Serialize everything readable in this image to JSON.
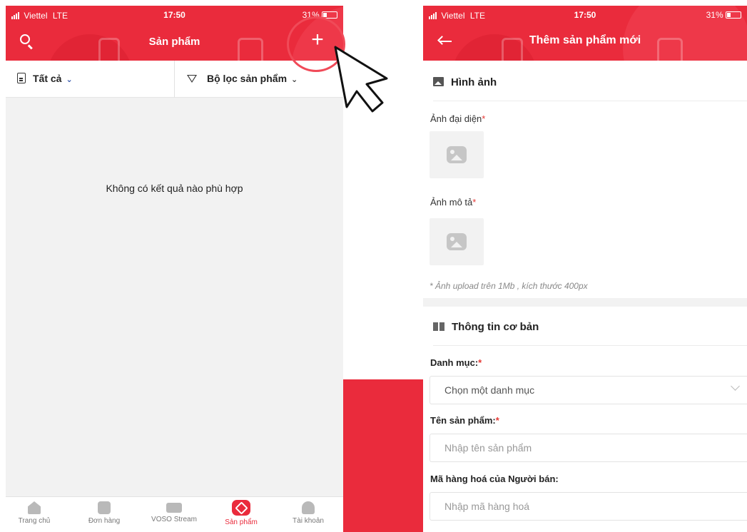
{
  "status_left": {
    "carrier": "Viettel",
    "network": "LTE",
    "time": "17:50",
    "battery": "31%"
  },
  "status_right": {
    "carrier": "Viettel",
    "network": "LTE",
    "time": "17:50",
    "battery": "31%"
  },
  "products_screen": {
    "title": "Sản phẩm",
    "add_symbol": "+",
    "filter_all": "Tất cả",
    "filter_product": "Bộ lọc sản phẩm",
    "empty_message": "Không có kết quả nào phù hợp",
    "tabs": [
      {
        "label": "Trang chủ",
        "icon": "home-icon"
      },
      {
        "label": "Đơn hàng",
        "icon": "orders-icon"
      },
      {
        "label": "VOSO Stream",
        "icon": "video-icon"
      },
      {
        "label": "Sản phẩm",
        "icon": "product-box-icon"
      },
      {
        "label": "Tài khoản",
        "icon": "account-icon"
      }
    ]
  },
  "add_product_screen": {
    "title": "Thêm sản phẩm mới",
    "images_section": "Hình ảnh",
    "avatar_label": "Ảnh đại diện",
    "desc_image_label": "Ảnh mô tả",
    "required_mark": "*",
    "upload_note": "* Ảnh upload trên 1Mb , kích thước 400px",
    "basic_info_section": "Thông tin cơ bản",
    "category_label": "Danh mục:",
    "category_placeholder": "Chọn một danh mục",
    "name_label": "Tên sản phẩm:",
    "name_placeholder": "Nhập tên sản phẩm",
    "sku_label": "Mã hàng hoá của Người bán:",
    "sku_placeholder": "Nhập mã hàng hoá"
  },
  "colors": {
    "brand_red": "#ea2b3c",
    "accent_blue": "#2a4fa8",
    "required_red": "#e53935"
  }
}
